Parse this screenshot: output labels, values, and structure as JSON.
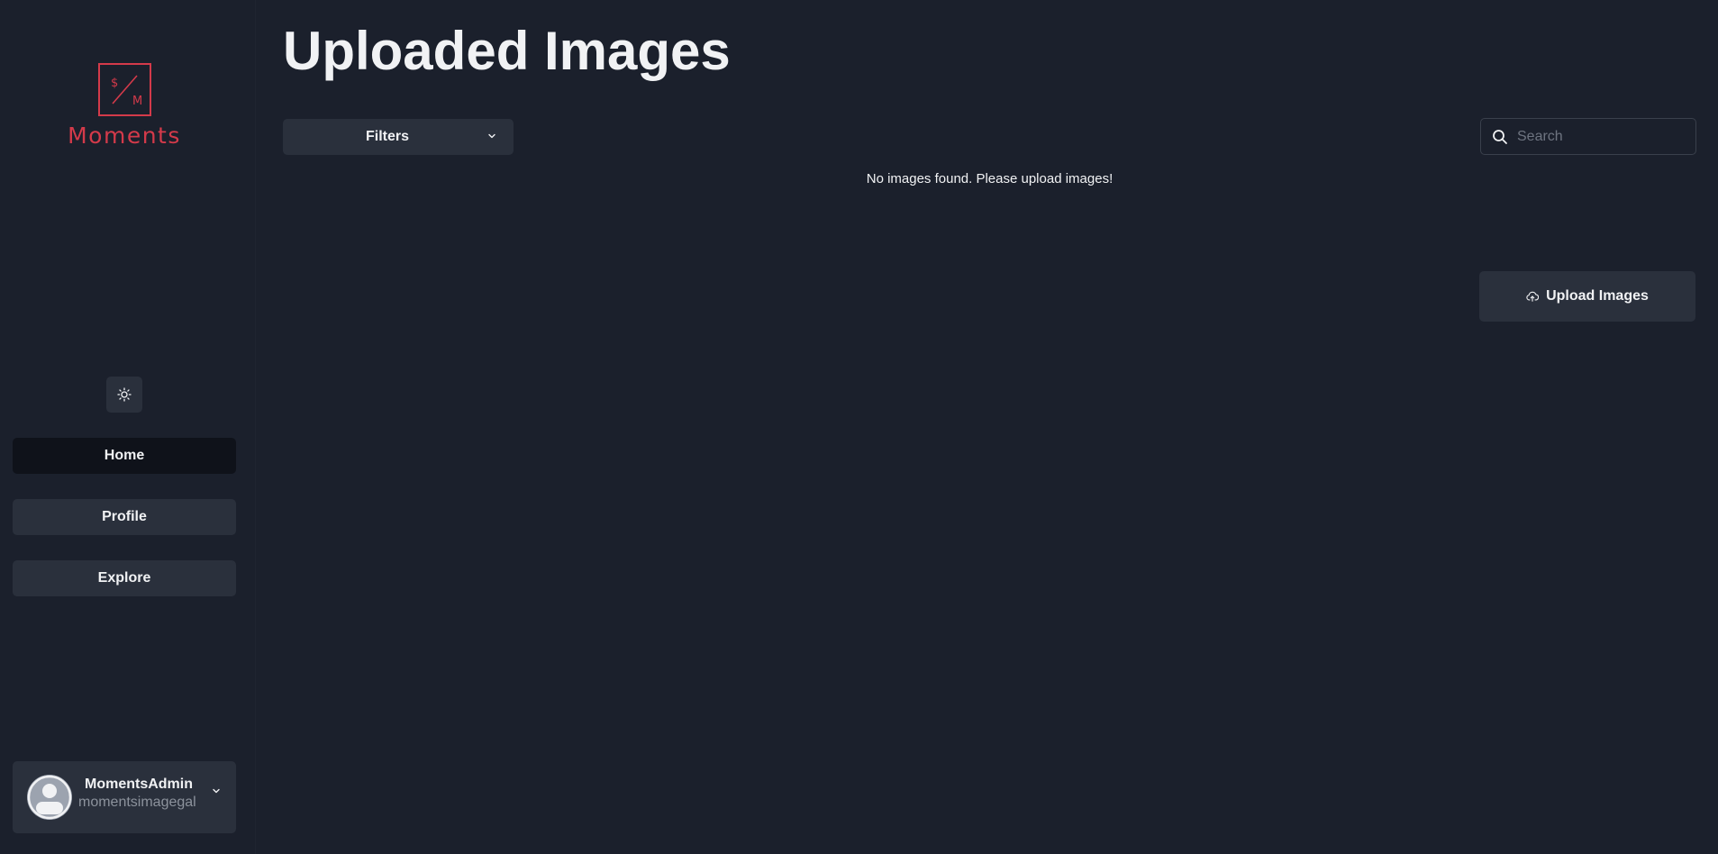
{
  "brand": {
    "name": "Moments",
    "logo_letters": "M",
    "accent_color": "#d43a4a"
  },
  "sidebar": {
    "theme_toggle_icon": "sun-icon",
    "nav": [
      {
        "label": "Home",
        "active": true
      },
      {
        "label": "Profile",
        "active": false
      },
      {
        "label": "Explore",
        "active": false
      }
    ],
    "user": {
      "name": "MomentsAdmin",
      "email": "momentsimagegal",
      "avatar_icon": "user-avatar-icon"
    }
  },
  "main": {
    "title": "Uploaded Images",
    "filters_label": "Filters",
    "search_placeholder": "Search",
    "search_value": "",
    "empty_message": "No images found. Please upload images!",
    "upload_label": "Upload Images"
  }
}
